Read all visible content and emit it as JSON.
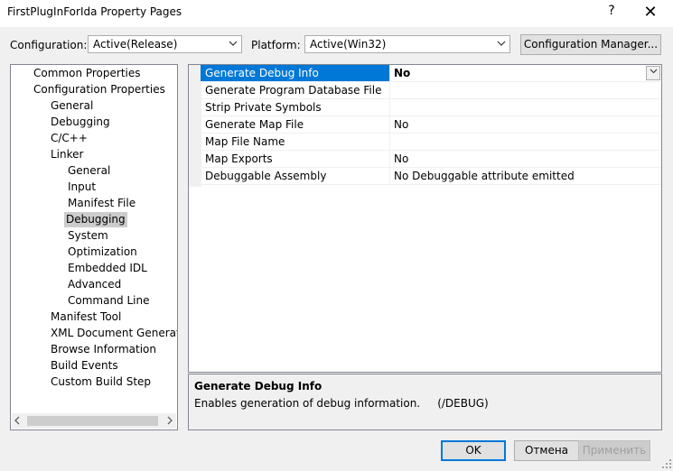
{
  "window": {
    "title": "FirstPlugInForIda Property Pages",
    "help_glyph": "?",
    "close_glyph": "✕"
  },
  "toolbar": {
    "configuration_label": "Configuration:",
    "configuration_value": "Active(Release)",
    "platform_label": "Platform:",
    "platform_value": "Active(Win32)",
    "config_manager_label": "Configuration Manager..."
  },
  "tree": {
    "items": [
      {
        "label": "Common Properties"
      },
      {
        "label": "Configuration Properties"
      },
      {
        "label": "General"
      },
      {
        "label": "Debugging"
      },
      {
        "label": "C/C++"
      },
      {
        "label": "Linker"
      },
      {
        "label": "General"
      },
      {
        "label": "Input"
      },
      {
        "label": "Manifest File"
      },
      {
        "label": "Debugging"
      },
      {
        "label": "System"
      },
      {
        "label": "Optimization"
      },
      {
        "label": "Embedded IDL"
      },
      {
        "label": "Advanced"
      },
      {
        "label": "Command Line"
      },
      {
        "label": "Manifest Tool"
      },
      {
        "label": "XML Document Generator"
      },
      {
        "label": "Browse Information"
      },
      {
        "label": "Build Events"
      },
      {
        "label": "Custom Build Step"
      }
    ]
  },
  "grid": {
    "rows": [
      {
        "name": "Generate Debug Info",
        "value": "No"
      },
      {
        "name": "Generate Program Database File",
        "value": ""
      },
      {
        "name": "Strip Private Symbols",
        "value": ""
      },
      {
        "name": "Generate Map File",
        "value": "No"
      },
      {
        "name": "Map File Name",
        "value": ""
      },
      {
        "name": "Map Exports",
        "value": "No"
      },
      {
        "name": "Debuggable Assembly",
        "value": "No Debuggable attribute emitted"
      }
    ]
  },
  "description": {
    "title": "Generate Debug Info",
    "text": "Enables generation of debug information.     (/DEBUG)"
  },
  "buttons": {
    "ok": "OK",
    "cancel": "Отмена",
    "apply": "Применить"
  },
  "colors": {
    "selection": "#0078d7",
    "tree_selection": "#cccccc"
  }
}
